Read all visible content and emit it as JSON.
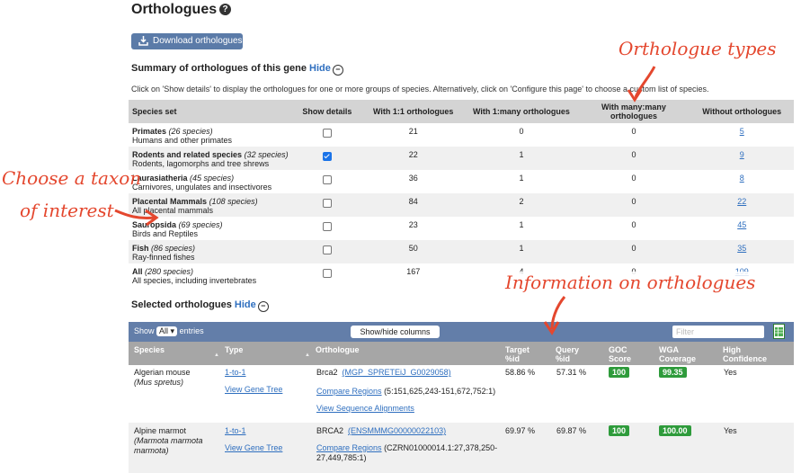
{
  "page": {
    "title": "Orthologues",
    "download_label": "Download orthologues",
    "summary_title": "Summary of orthologues of this gene",
    "hide_label": "Hide",
    "info_text": "Click on 'Show details' to display the orthologues for one or more groups of species. Alternatively, click on 'Configure this page' to choose a custom list of species."
  },
  "summary": {
    "headers": [
      "Species set",
      "Show details",
      "With 1:1 orthologues",
      "With 1:many orthologues",
      "With many:many orthologues",
      "Without orthologues"
    ],
    "rows": [
      {
        "name": "Primates",
        "count": "(26 species)",
        "desc": "Humans and other primates",
        "checked": false,
        "one_one": "21",
        "one_many": "0",
        "many_many": "0",
        "without": "5"
      },
      {
        "name": "Rodents and related species",
        "count": "(32 species)",
        "desc": "Rodents, lagomorphs and tree shrews",
        "checked": true,
        "one_one": "22",
        "one_many": "1",
        "many_many": "0",
        "without": "9"
      },
      {
        "name": "Laurasiatheria",
        "count": "(45 species)",
        "desc": "Carnivores, ungulates and insectivores",
        "checked": false,
        "one_one": "36",
        "one_many": "1",
        "many_many": "0",
        "without": "8"
      },
      {
        "name": "Placental Mammals",
        "count": "(108 species)",
        "desc": "All placental mammals",
        "checked": false,
        "one_one": "84",
        "one_many": "2",
        "many_many": "0",
        "without": "22"
      },
      {
        "name": "Sauropsida",
        "count": "(69 species)",
        "desc": "Birds and Reptiles",
        "checked": false,
        "one_one": "23",
        "one_many": "1",
        "many_many": "0",
        "without": "45"
      },
      {
        "name": "Fish",
        "count": "(86 species)",
        "desc": "Ray-finned fishes",
        "checked": false,
        "one_one": "50",
        "one_many": "1",
        "many_many": "0",
        "without": "35"
      },
      {
        "name": "All",
        "count": "(280 species)",
        "desc": "All species, including invertebrates",
        "checked": false,
        "one_one": "167",
        "one_many": "4",
        "many_many": "0",
        "without": "109"
      }
    ]
  },
  "selected": {
    "title": "Selected orthologues",
    "hide_label": "Hide",
    "show_label": "Show",
    "entries_value": "All",
    "entries_label": "entries",
    "showhide_label": "Show/hide columns",
    "filter_placeholder": "Filter",
    "headers": {
      "species": "Species",
      "type": "Type",
      "orthologue": "Orthologue",
      "target": "Target %id",
      "query": "Query %id",
      "goc": "GOC Score",
      "wga": "WGA Coverage",
      "high": "High Confidence"
    },
    "rows": [
      {
        "species": "Algerian mouse",
        "latin": "(Mus spretus)",
        "type": "1-to-1",
        "view_tree": "View Gene Tree",
        "gene": "Brca2",
        "gene_id": "(MGP_SPRETEiJ_G0029058)",
        "compare": "Compare Regions",
        "location": "(5:151,625,243-151,672,752:1)",
        "view_align": "View Sequence Alignments",
        "target": "58.86 %",
        "query": "57.31 %",
        "goc": "100",
        "wga": "99.35",
        "high": "Yes"
      },
      {
        "species": "Alpine marmot",
        "latin": "(Marmota marmota marmota)",
        "type": "1-to-1",
        "view_tree": "View Gene Tree",
        "gene": "BRCA2",
        "gene_id": "(ENSMMMG00000022103)",
        "compare": "Compare Regions",
        "location": "(CZRN01000014.1:27,378,250-27,449,785:1)",
        "target": "69.97 %",
        "query": "69.87 %",
        "goc": "100",
        "wga": "100.00",
        "high": "Yes"
      }
    ]
  },
  "annotations": {
    "orthologue_types": "Orthologue types",
    "choose_taxon_1": "Choose a taxon",
    "choose_taxon_2": "of interest",
    "information": "Information on orthologues"
  },
  "colors": {
    "annotation": "#e4472e",
    "header_bar": "#637ea9",
    "badge": "#2e9b3b",
    "link": "#2f6fbf"
  }
}
